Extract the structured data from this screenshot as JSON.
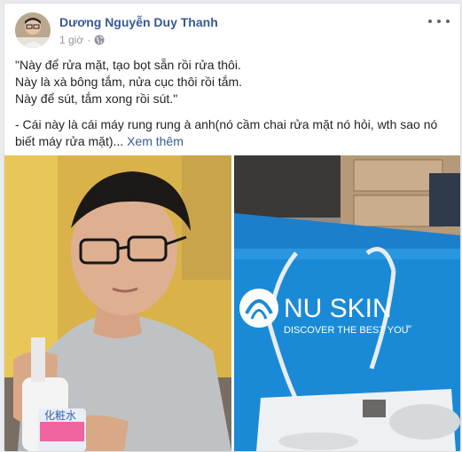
{
  "post": {
    "author": "Dương Nguyễn Duy Thanh",
    "time": "1 giờ",
    "privacy_dot": "·",
    "lines": [
      "\"Này để rửa mặt, tạo bọt sẵn rồi rửa thôi.",
      "Này là xà bông tắm, nửa cục thôi rồi tắm.",
      "Này để sút, tắm xong rồi sút.\"",
      "- Cái này là cái máy rung rung à anh(nó cầm chai rửa mặt nó hỏi, wth sao nó",
      "biết máy rửa mặt)..."
    ],
    "see_more": "Xem thêm"
  },
  "photos": {
    "left_product_label_top": "化粧水",
    "right_brand": "NU SKIN",
    "right_tagline": "DISCOVER THE BEST YOU",
    "right_tagline_tm": "™"
  },
  "colors": {
    "link": "#385898",
    "bag_blue": "#1a8ad6",
    "background": "#e9ebee"
  },
  "icons": [
    "globe-icon",
    "more-options-icon",
    "nuskin-logo-icon"
  ]
}
